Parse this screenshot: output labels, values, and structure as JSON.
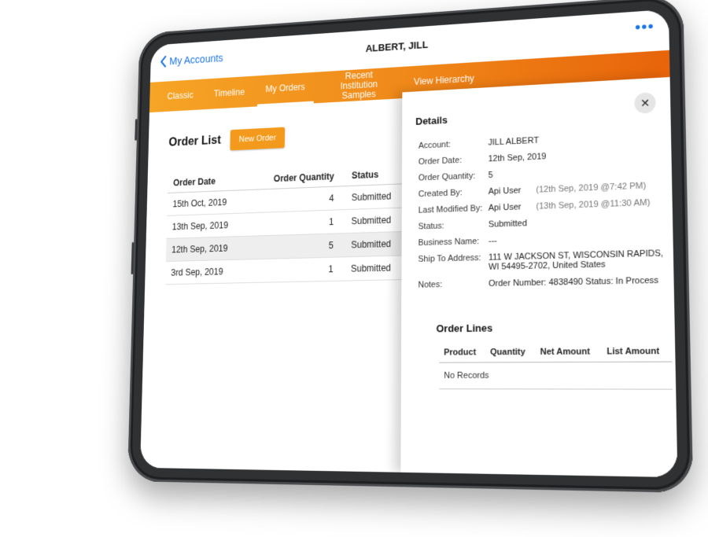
{
  "header": {
    "back_label": "My Accounts",
    "title": "ALBERT, JILL",
    "more_label": "•••"
  },
  "tabs": [
    {
      "label": "Classic",
      "active": false
    },
    {
      "label": "Timeline",
      "active": false
    },
    {
      "label": "My Orders",
      "active": true
    },
    {
      "label": "Recent Institution Samples",
      "active": false
    },
    {
      "label": "View Hierarchy",
      "active": false
    }
  ],
  "order_list": {
    "title": "Order List",
    "new_button": "New Order",
    "columns": [
      "Order Date",
      "Order Quantity",
      "Status"
    ],
    "rows": [
      {
        "date": "15th Oct, 2019",
        "quantity": "4",
        "status": "Submitted",
        "selected": false
      },
      {
        "date": "13th Sep, 2019",
        "quantity": "1",
        "status": "Submitted",
        "selected": false
      },
      {
        "date": "12th Sep, 2019",
        "quantity": "5",
        "status": "Submitted",
        "selected": true
      },
      {
        "date": "3rd Sep, 2019",
        "quantity": "1",
        "status": "Submitted",
        "selected": false
      }
    ]
  },
  "details": {
    "title": "Details",
    "close_label": "✕",
    "fields": {
      "account": {
        "label": "Account:",
        "value": "JILL ALBERT"
      },
      "order_date": {
        "label": "Order Date:",
        "value": "12th Sep, 2019"
      },
      "order_quantity": {
        "label": "Order Quantity:",
        "value": "5"
      },
      "created_by": {
        "label": "Created By:",
        "value": "Api User",
        "meta": "(12th Sep, 2019 @7:42 PM)"
      },
      "last_modified_by": {
        "label": "Last Modified By:",
        "value": "Api User",
        "meta": "(13th Sep, 2019 @11:30 AM)"
      },
      "status": {
        "label": "Status:",
        "value": "Submitted"
      },
      "business_name": {
        "label": "Business Name:",
        "value": "---"
      },
      "ship_to": {
        "label": "Ship To Address:",
        "value": "111 W JACKSON ST, WISCONSIN RAPIDS, WI 54495-2702, United States"
      },
      "notes": {
        "label": "Notes:",
        "value": "Order Number: 4838490 Status: In Process"
      }
    },
    "order_lines": {
      "title": "Order Lines",
      "columns": [
        "Product",
        "Quantity",
        "Net Amount",
        "List Amount"
      ],
      "empty_text": "No Records"
    }
  },
  "colors": {
    "tab_bar_start": "#f6a526",
    "tab_bar_end": "#e8640a",
    "accent_blue": "#1a73e8",
    "button_orange": "#f39a1c"
  }
}
